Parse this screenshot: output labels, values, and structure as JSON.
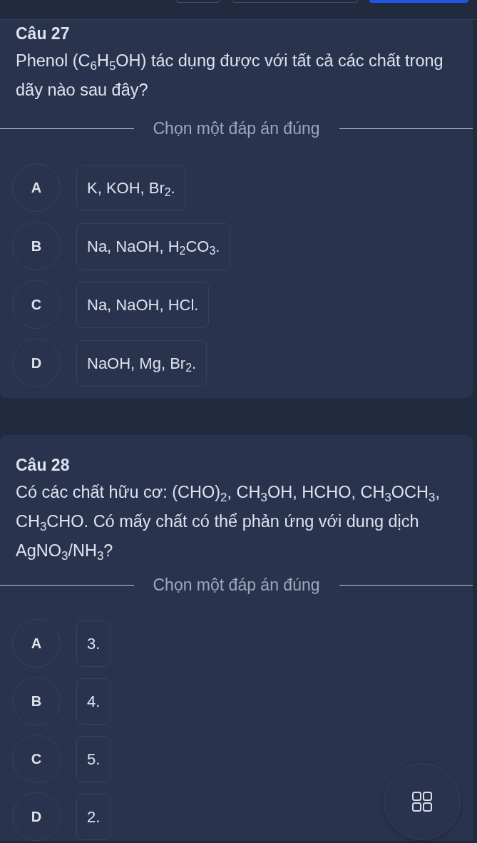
{
  "toolbar": {
    "buttons": [
      {
        "kind": "outline"
      },
      {
        "kind": "outline"
      },
      {
        "kind": "primary"
      }
    ]
  },
  "questions": [
    {
      "title": "Câu 27",
      "text": "Phenol (C$_{6}$H$_{5}$OH) tác dụng được với tất cả các chất trong dãy nào sau đây?",
      "prompt": "Chọn một đáp án đúng",
      "options": [
        {
          "letter": "A",
          "text": "K, KOH, Br$_{2}$.",
          "selected": false
        },
        {
          "letter": "B",
          "text": "Na, NaOH, H$_{2}$CO$_{3}$.",
          "selected": false
        },
        {
          "letter": "C",
          "text": "Na, NaOH, HCl.",
          "selected": false
        },
        {
          "letter": "D",
          "text": "NaOH, Mg, Br$_{2}$.",
          "selected": false
        }
      ]
    },
    {
      "title": "Câu 28",
      "text": "Có các chất hữu cơ: (CHO)$_{2}$, CH$_{3}$OH, HCHO, CH$_{3}$OCH$_{3}$, CH$_{3}$CHO. Có mấy chất có thể phản ứng với dung dịch AgNO$_{3}$/NH$_{3}$?",
      "prompt": "Chọn một đáp án đúng",
      "options": [
        {
          "letter": "A",
          "text": "3.",
          "selected": false
        },
        {
          "letter": "B",
          "text": "4.",
          "selected": false
        },
        {
          "letter": "C",
          "text": "5.",
          "selected": false
        },
        {
          "letter": "D",
          "text": "2.",
          "selected": false
        }
      ]
    }
  ]
}
